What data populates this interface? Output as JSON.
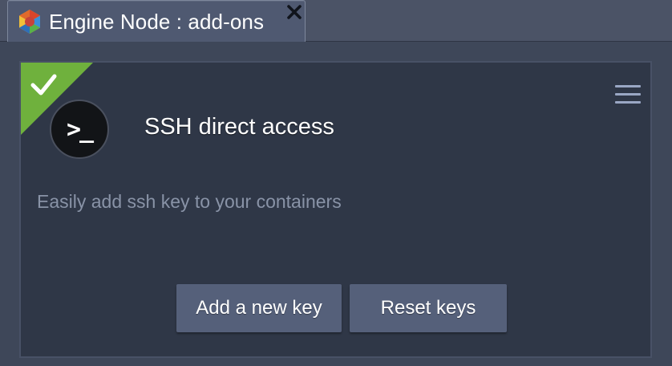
{
  "tab": {
    "title": "Engine Node : add-ons",
    "icon": "app-logo-icon",
    "close_icon": "close-icon"
  },
  "addon": {
    "status": "installed",
    "badge_icon": "checkmark-icon",
    "logo_icon": "terminal-icon",
    "logo_text": ">_",
    "title": "SSH direct access",
    "description": "Easily add ssh key to your containers",
    "menu_icon": "hamburger-menu-icon"
  },
  "actions": {
    "add_label": "Add a new key",
    "reset_label": "Reset keys"
  },
  "colors": {
    "badge_green": "#6fb13d",
    "card_bg": "#2f3747",
    "button_bg": "#55607a",
    "description_text": "#8993a7"
  }
}
